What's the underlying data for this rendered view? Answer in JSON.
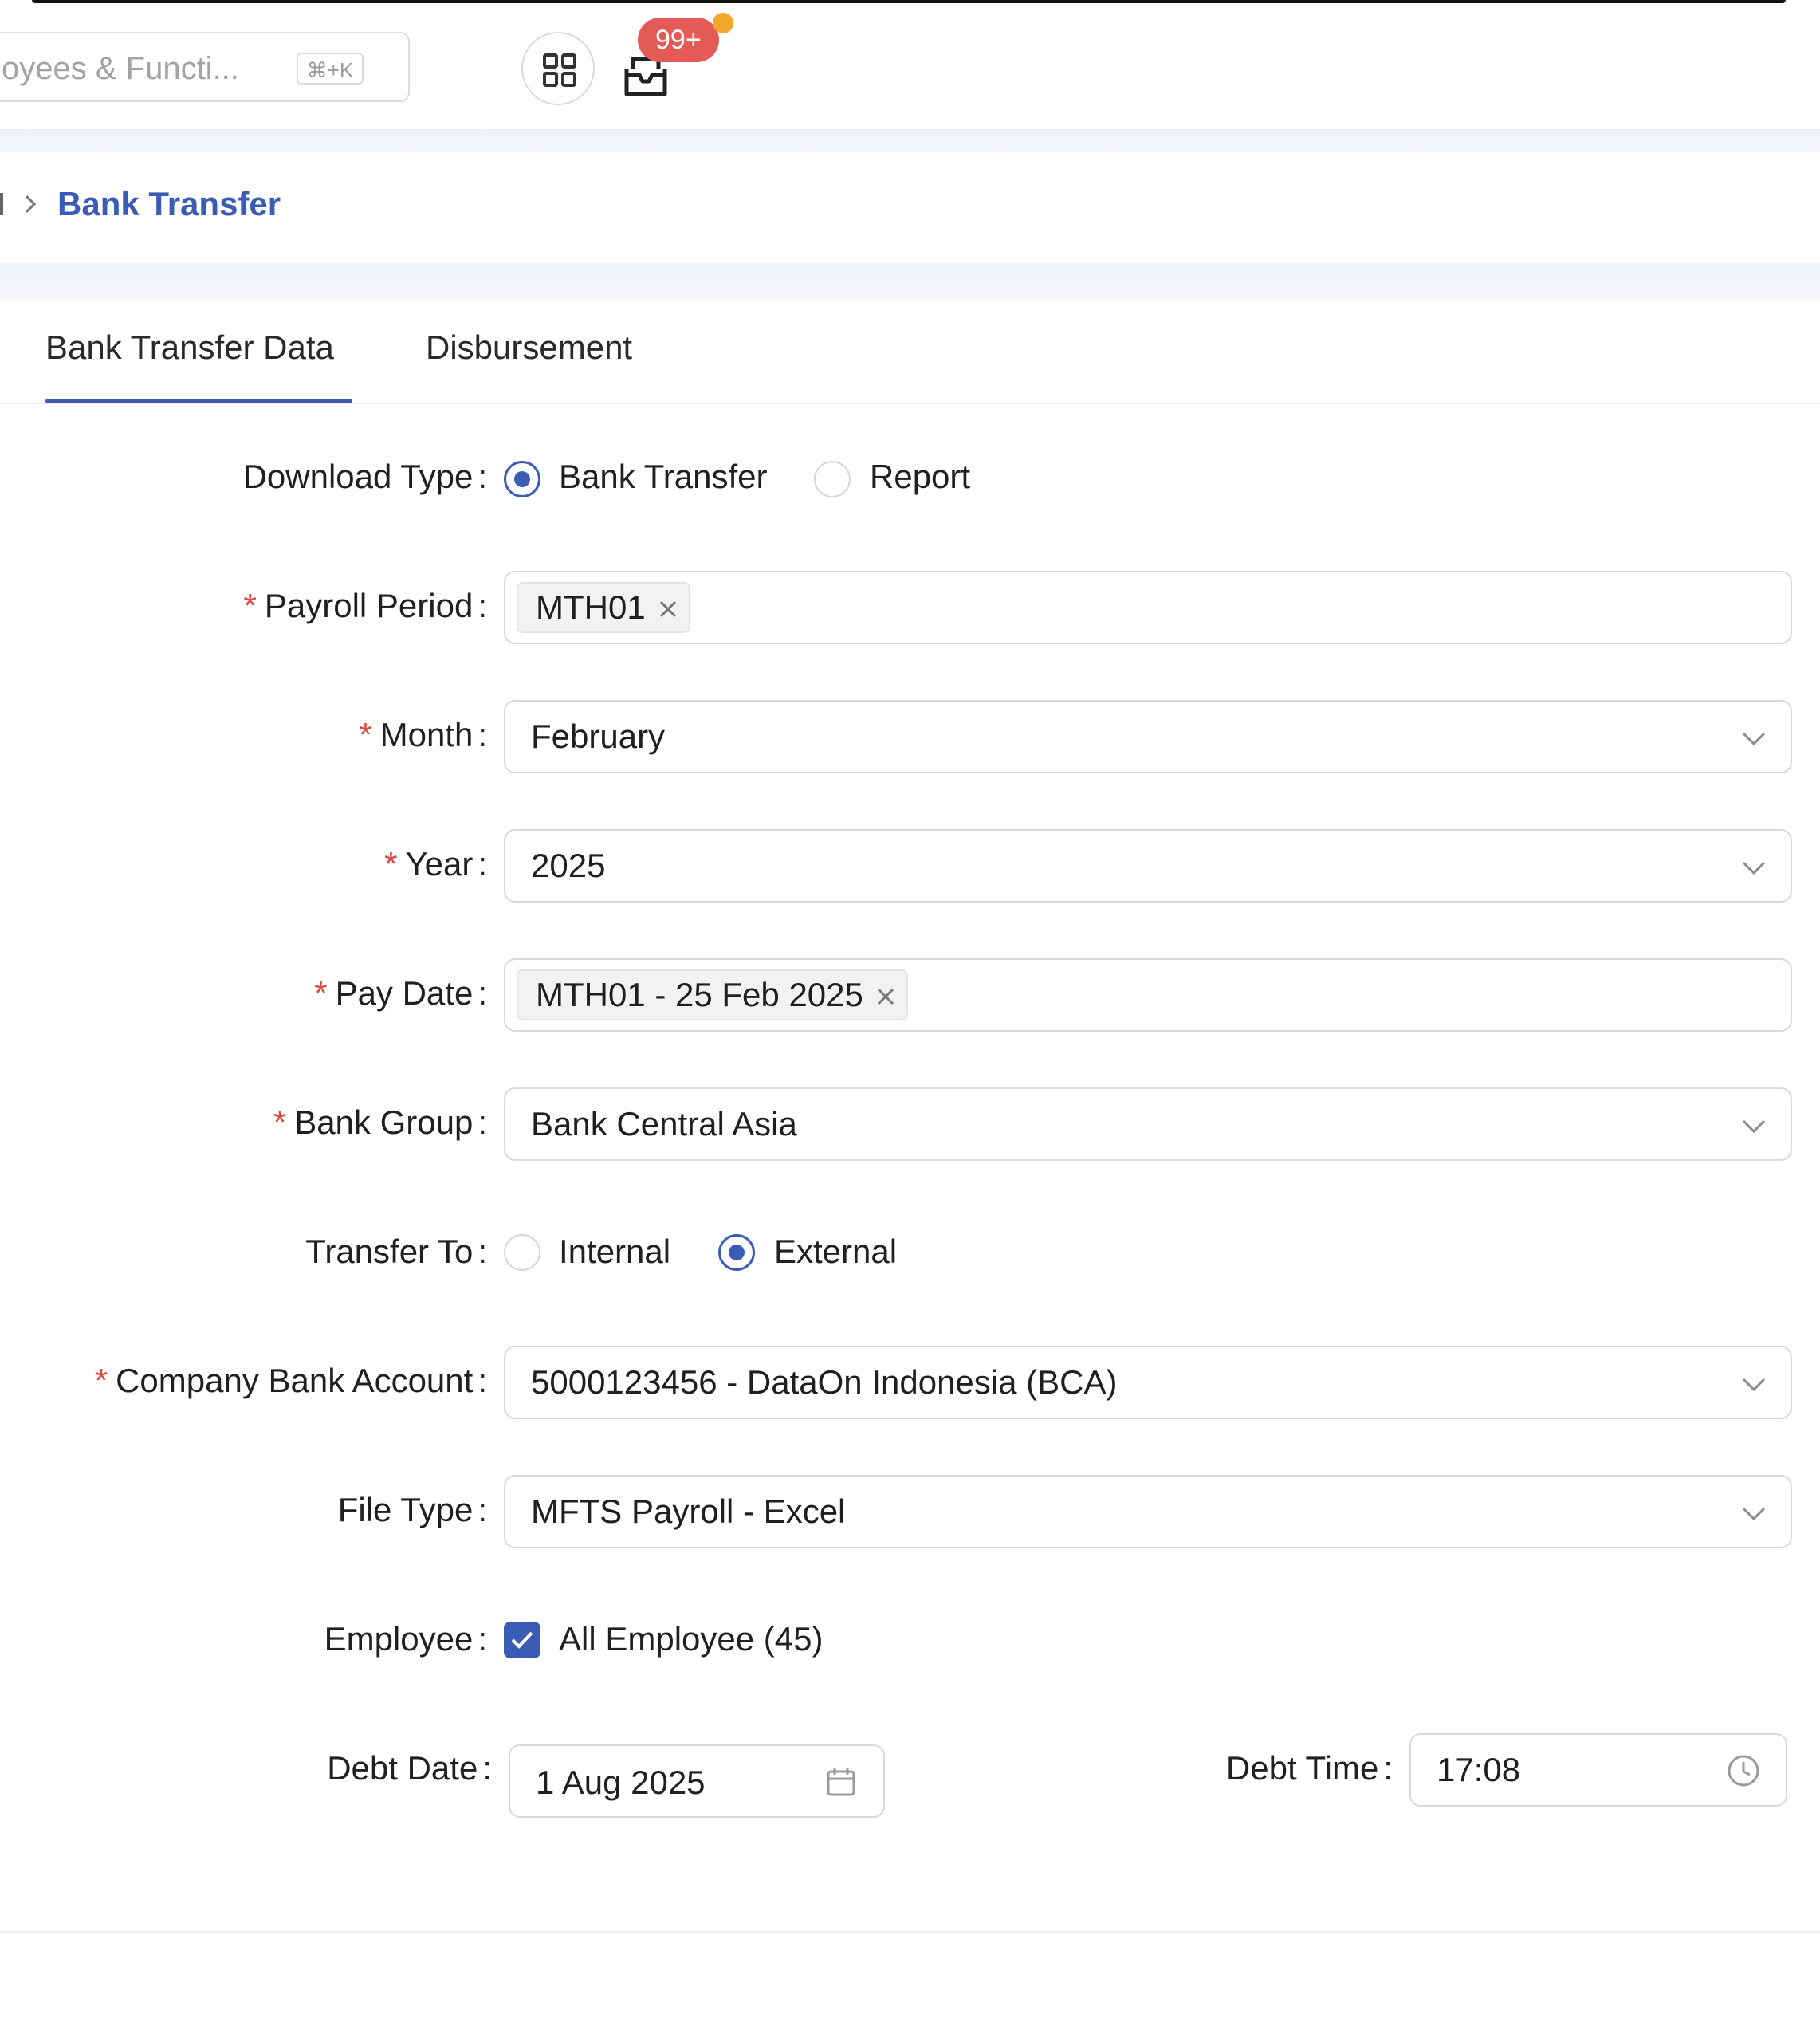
{
  "header": {
    "search_placeholder": "oyees & Functi...",
    "search_shortcut": "⌘+K",
    "notification_count": "99+"
  },
  "breadcrumb": {
    "current": "Bank Transfer"
  },
  "tabs": [
    {
      "label": "Bank Transfer Data",
      "active": true
    },
    {
      "label": "Disbursement",
      "active": false
    }
  ],
  "form": {
    "download_type": {
      "label": "Download Type",
      "options": [
        {
          "label": "Bank Transfer",
          "selected": true
        },
        {
          "label": "Report",
          "selected": false
        }
      ]
    },
    "payroll_period": {
      "label": "Payroll Period",
      "required": true,
      "tags": [
        "MTH01"
      ]
    },
    "month": {
      "label": "Month",
      "required": true,
      "value": "February"
    },
    "year": {
      "label": "Year",
      "required": true,
      "value": "2025"
    },
    "pay_date": {
      "label": "Pay Date",
      "required": true,
      "tags": [
        "MTH01 - 25 Feb 2025"
      ]
    },
    "bank_group": {
      "label": "Bank Group",
      "required": true,
      "value": "Bank Central Asia"
    },
    "transfer_to": {
      "label": "Transfer To",
      "options": [
        {
          "label": "Internal",
          "selected": false
        },
        {
          "label": "External",
          "selected": true
        }
      ]
    },
    "company_bank_account": {
      "label": "Company Bank Account",
      "required": true,
      "value": "5000123456 - DataOn Indonesia (BCA)"
    },
    "file_type": {
      "label": "File Type",
      "value": "MFTS Payroll - Excel"
    },
    "employee": {
      "label": "Employee",
      "checkbox_label": "All Employee (45)",
      "checked": true
    },
    "debt_date": {
      "label": "Debt Date",
      "value": "1 Aug 2025"
    },
    "debt_time": {
      "label": "Debt Time",
      "value": "17:08"
    }
  },
  "colors": {
    "accent": "#3a5cb5",
    "required": "#e0473f",
    "badge": "#e45a57",
    "badge_dot": "#f0a72a"
  }
}
